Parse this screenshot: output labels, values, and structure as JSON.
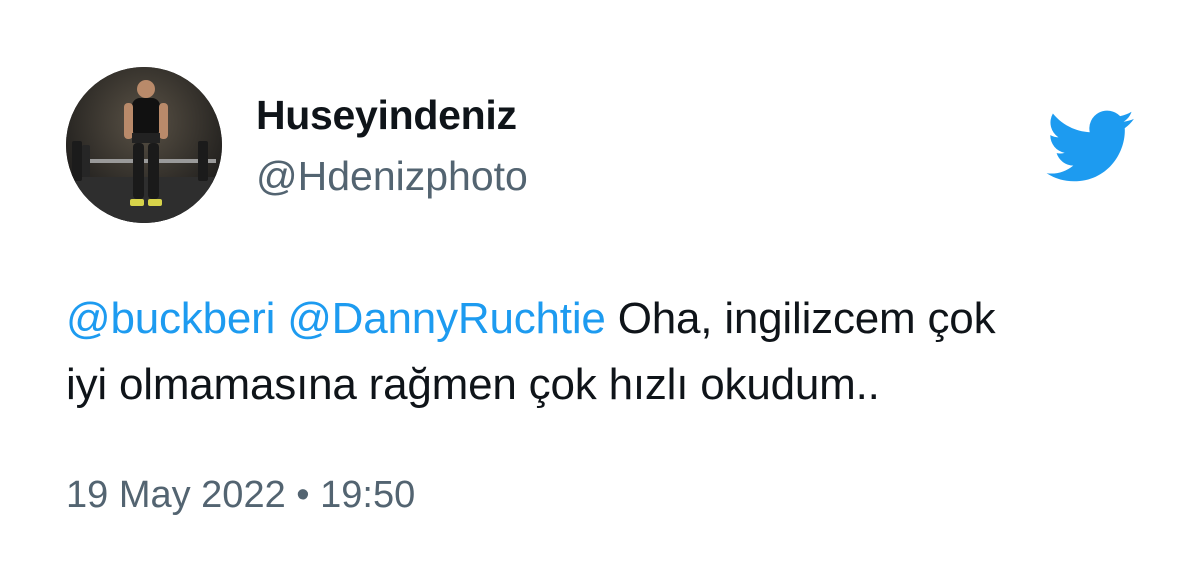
{
  "author": {
    "display_name": "Huseyindeniz",
    "handle": "@Hdenizphoto",
    "avatar_icon": "gym-deadlift-photo"
  },
  "brand": {
    "icon": "twitter-bird-icon",
    "color": "#1d9bf0"
  },
  "tweet": {
    "mentions": [
      "@buckberi",
      "@DannyRuchtie"
    ],
    "text_line1": "Oha, ingilizcem çok",
    "text_line2": "iyi olmamasına rağmen çok hızlı okudum..",
    "date": "19 May 2022",
    "separator": "•",
    "time": "19:50"
  },
  "colors": {
    "text": "#0f1419",
    "secondary": "#536471",
    "link": "#1d9bf0"
  }
}
